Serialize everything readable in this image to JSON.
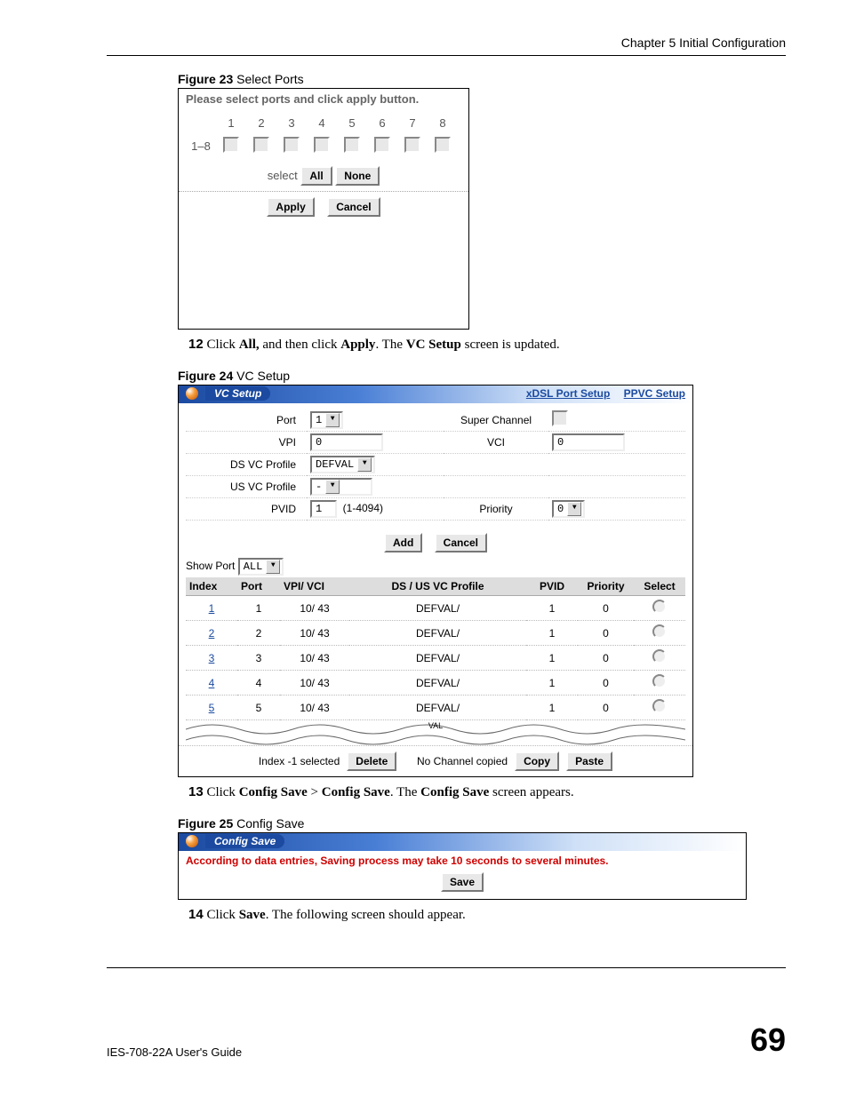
{
  "header": {
    "chapter": "Chapter 5 Initial Configuration"
  },
  "fig23": {
    "caption_bold": "Figure 23",
    "caption_rest": "   Select Ports",
    "title": "Please select ports and click apply button.",
    "row_label": "1–8",
    "cols": [
      "1",
      "2",
      "3",
      "4",
      "5",
      "6",
      "7",
      "8"
    ],
    "select_label": "select",
    "btn_all": "All",
    "btn_none": "None",
    "btn_apply": "Apply",
    "btn_cancel": "Cancel"
  },
  "step12": {
    "num": "12",
    "t1": "Click ",
    "b1": "All,",
    "t2": " and then click ",
    "b2": "Apply",
    "t3": ". The ",
    "b3": "VC Setup",
    "t4": " screen is updated."
  },
  "fig24": {
    "caption_bold": "Figure 24",
    "caption_rest": "   VC Setup",
    "tab_title": "VC Setup",
    "link1": "xDSL Port Setup",
    "link2": "PPVC Setup",
    "labels": {
      "port": "Port",
      "super_channel": "Super Channel",
      "vpi": "VPI",
      "vci": "VCI",
      "dsvc": "DS VC Profile",
      "usvc": "US VC Profile",
      "pvid": "PVID",
      "priority": "Priority",
      "pvid_hint": "(1-4094)"
    },
    "values": {
      "port": "1",
      "vpi": "0",
      "vci": "0",
      "dsvc": "DEFVAL",
      "usvc": "-",
      "pvid": "1",
      "priority": "0"
    },
    "btn_add": "Add",
    "btn_cancel": "Cancel",
    "show_port_label": "Show Port",
    "show_port_value": "ALL",
    "table": {
      "headers": [
        "Index",
        "Port",
        "VPI/ VCI",
        "DS / US VC Profile",
        "PVID",
        "Priority",
        "Select"
      ],
      "rows": [
        {
          "index": "1",
          "port": "1",
          "vpivci": "10/ 43",
          "profile": "DEFVAL/",
          "pvid": "1",
          "priority": "0"
        },
        {
          "index": "2",
          "port": "2",
          "vpivci": "10/ 43",
          "profile": "DEFVAL/",
          "pvid": "1",
          "priority": "0"
        },
        {
          "index": "3",
          "port": "3",
          "vpivci": "10/ 43",
          "profile": "DEFVAL/",
          "pvid": "1",
          "priority": "0"
        },
        {
          "index": "4",
          "port": "4",
          "vpivci": "10/ 43",
          "profile": "DEFVAL/",
          "pvid": "1",
          "priority": "0"
        },
        {
          "index": "5",
          "port": "5",
          "vpivci": "10/ 43",
          "profile": "DEFVAL/",
          "pvid": "1",
          "priority": "0"
        }
      ],
      "wave_text": "VAL"
    },
    "footer": {
      "selected": "Index -1 selected",
      "btn_delete": "Delete",
      "nocopy": "No Channel copied",
      "btn_copy": "Copy",
      "btn_paste": "Paste"
    }
  },
  "step13": {
    "num": "13",
    "t1": "Click ",
    "b1": "Config Save",
    "t2": " > ",
    "b2": "Config Save",
    "t3": ". The ",
    "b3": "Config Save",
    "t4": " screen appears."
  },
  "fig25": {
    "caption_bold": "Figure 25",
    "caption_rest": "   Config Save",
    "tab_title": "Config Save",
    "warn": "According to data entries, Saving process may take 10 seconds to several minutes.",
    "btn_save": "Save"
  },
  "step14": {
    "num": "14",
    "t1": "Click ",
    "b1": "Save",
    "t2": ". The following screen should appear."
  },
  "footer": {
    "guide": "IES-708-22A User's Guide",
    "page": "69"
  }
}
